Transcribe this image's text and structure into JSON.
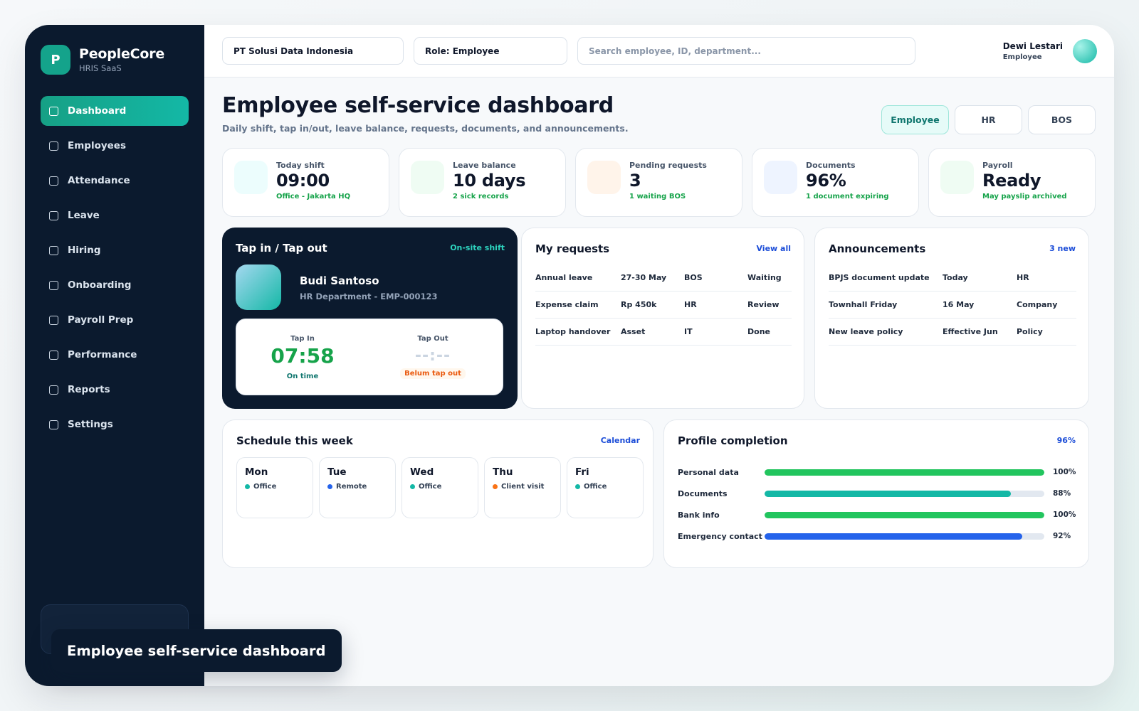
{
  "brand": {
    "logo_letter": "P",
    "name": "PeopleCore",
    "sub": "HRIS SaaS"
  },
  "nav": [
    {
      "label": "Dashboard",
      "active": true
    },
    {
      "label": "Employees"
    },
    {
      "label": "Attendance"
    },
    {
      "label": "Leave"
    },
    {
      "label": "Hiring"
    },
    {
      "label": "Onboarding"
    },
    {
      "label": "Payroll Prep"
    },
    {
      "label": "Performance"
    },
    {
      "label": "Reports"
    },
    {
      "label": "Settings"
    }
  ],
  "topbar": {
    "company": "PT Solusi Data Indonesia",
    "role": "Role: Employee",
    "search_placeholder": "Search employee, ID, department...",
    "user_name": "Dewi Lestari",
    "user_role": "Employee"
  },
  "page": {
    "title": "Employee self-service dashboard",
    "subtitle": "Daily shift, tap in/out, leave balance, requests, documents, and announcements."
  },
  "role_tabs": [
    "Employee",
    "HR",
    "BOS"
  ],
  "kpis": [
    {
      "label": "Today shift",
      "value": "09:00",
      "note": "Office - Jakarta HQ",
      "color": "#ecfdfd"
    },
    {
      "label": "Leave balance",
      "value": "10 days",
      "note": "2 sick records",
      "color": "#effcf3"
    },
    {
      "label": "Pending requests",
      "value": "3",
      "note": "1 waiting BOS",
      "color": "#fff4ea"
    },
    {
      "label": "Documents",
      "value": "96%",
      "note": "1 document expiring",
      "color": "#eef4ff"
    },
    {
      "label": "Payroll",
      "value": "Ready",
      "note": "May payslip archived",
      "color": "#effcf3"
    }
  ],
  "tap": {
    "title": "Tap in / Tap out",
    "badge": "On-site shift",
    "name": "Budi Santoso",
    "dept": "HR Department - EMP-000123",
    "in_label": "Tap In",
    "in_time": "07:58",
    "in_status": "On time",
    "out_label": "Tap Out",
    "out_time": "--:--",
    "out_status": "Belum tap out"
  },
  "requests": {
    "title": "My requests",
    "link": "View all",
    "rows": [
      [
        "Annual leave",
        "27-30 May",
        "BOS",
        "Waiting"
      ],
      [
        "Expense claim",
        "Rp 450k",
        "HR",
        "Review"
      ],
      [
        "Laptop handover",
        "Asset",
        "IT",
        "Done"
      ]
    ]
  },
  "announcements": {
    "title": "Announcements",
    "link": "3 new",
    "rows": [
      [
        "BPJS document update",
        "Today",
        "HR"
      ],
      [
        "Townhall Friday",
        "16 May",
        "Company"
      ],
      [
        "New leave policy",
        "Effective Jun",
        "Policy"
      ]
    ]
  },
  "schedule": {
    "title": "Schedule this week",
    "link": "Calendar",
    "days": [
      {
        "day": "Mon",
        "type": "Office",
        "color": "#14b8a6"
      },
      {
        "day": "Tue",
        "type": "Remote",
        "color": "#2563eb"
      },
      {
        "day": "Wed",
        "type": "Office",
        "color": "#14b8a6"
      },
      {
        "day": "Thu",
        "type": "Client visit",
        "color": "#f97316"
      },
      {
        "day": "Fri",
        "type": "Office",
        "color": "#14b8a6"
      }
    ]
  },
  "profile": {
    "title": "Profile completion",
    "link": "96%",
    "rows": [
      {
        "label": "Personal data",
        "value": "100%",
        "pct": 100,
        "color": "#22c55e"
      },
      {
        "label": "Documents",
        "value": "88%",
        "pct": 88,
        "color": "#14b8a6"
      },
      {
        "label": "Bank info",
        "value": "100%",
        "pct": 100,
        "color": "#22c55e"
      },
      {
        "label": "Emergency contact",
        "value": "92%",
        "pct": 92,
        "color": "#2563eb"
      }
    ]
  },
  "toast": "Employee self-service dashboard"
}
